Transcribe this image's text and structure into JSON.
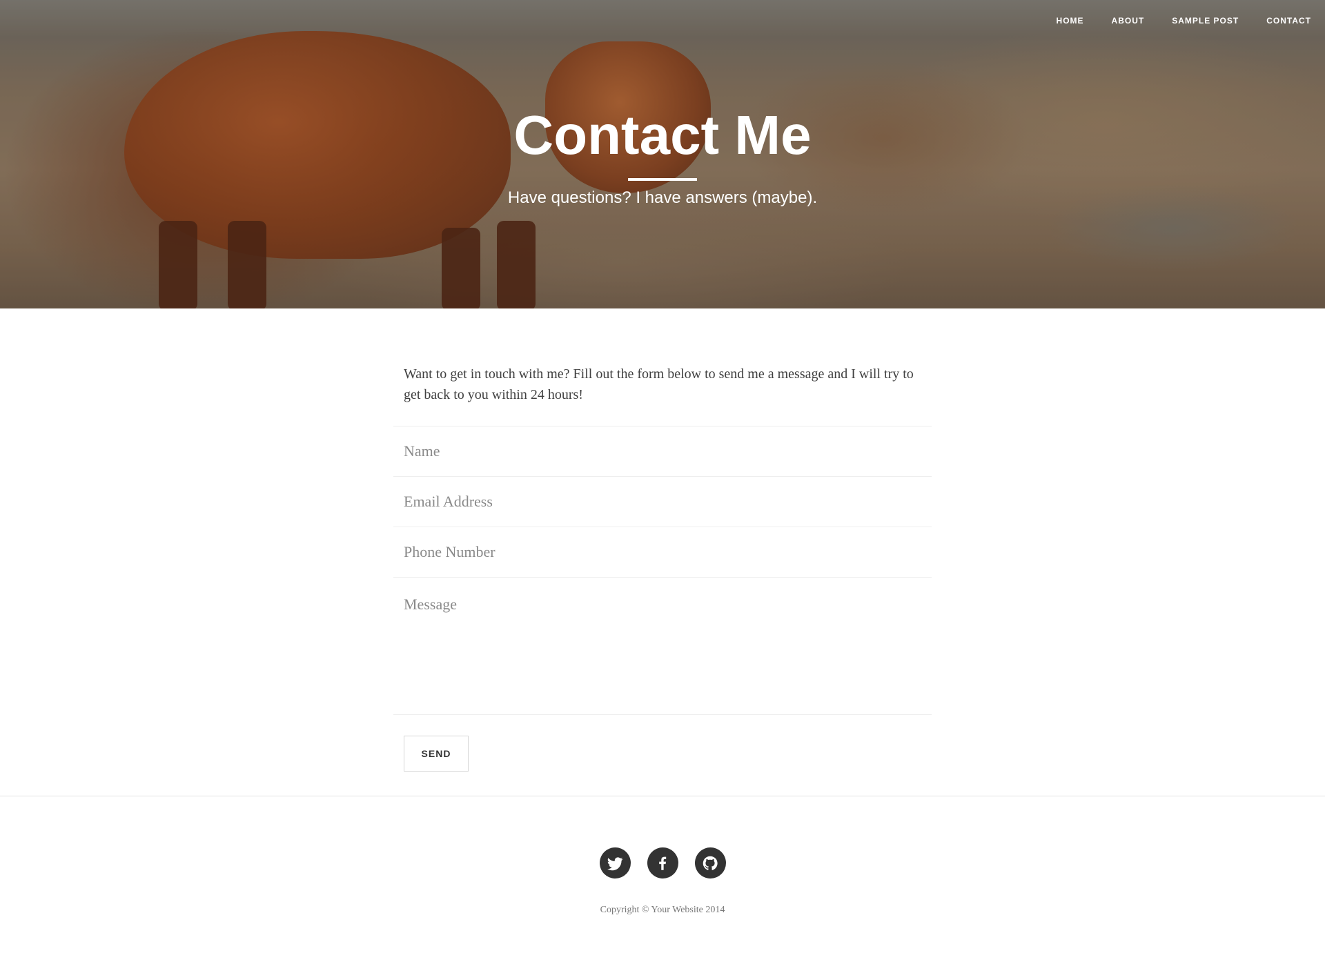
{
  "nav": {
    "items": [
      {
        "label": "HOME"
      },
      {
        "label": "ABOUT"
      },
      {
        "label": "SAMPLE POST"
      },
      {
        "label": "CONTACT"
      }
    ]
  },
  "header": {
    "title": "Contact Me",
    "subheading": "Have questions? I have answers (maybe)."
  },
  "main": {
    "intro": "Want to get in touch with me? Fill out the form below to send me a message and I will try to get back to you within 24 hours!",
    "form": {
      "name_placeholder": "Name",
      "email_placeholder": "Email Address",
      "phone_placeholder": "Phone Number",
      "message_placeholder": "Message",
      "send_label": "SEND"
    }
  },
  "footer": {
    "social": [
      {
        "icon": "twitter-icon"
      },
      {
        "icon": "facebook-icon"
      },
      {
        "icon": "github-icon"
      }
    ],
    "copyright": "Copyright © Your Website 2014"
  }
}
